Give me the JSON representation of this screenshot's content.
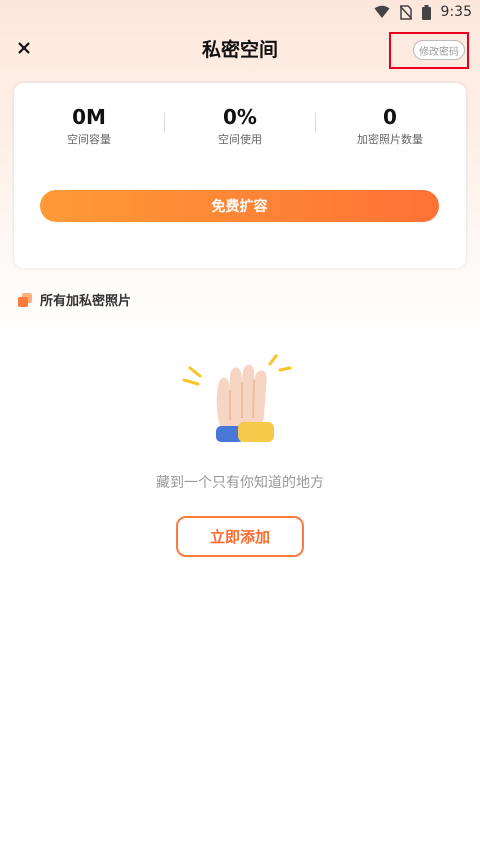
{
  "status_bar": {
    "time": "9:35",
    "icons": [
      "wifi-icon",
      "no-sim-icon",
      "battery-icon"
    ]
  },
  "header": {
    "title": "私密空间",
    "change_password": "修改密码",
    "close_icon": "close-icon"
  },
  "stats": [
    {
      "value": "0M",
      "label": "空间容量"
    },
    {
      "value": "0%",
      "label": "空间使用"
    },
    {
      "value": "0",
      "label": "加密照片数量"
    }
  ],
  "expand_button": "免费扩容",
  "section": {
    "title": "所有加私密照片",
    "icon": "photos-stack-icon"
  },
  "empty_state": {
    "illustration": "raised-hand-illustration",
    "text": "藏到一个只有你知道的地方",
    "action": "立即添加"
  },
  "colors": {
    "accent": "#ff7a3d",
    "gradient_start": "#ff9a36",
    "gradient_end": "#ff7236",
    "highlight_frame": "#e8001c"
  }
}
